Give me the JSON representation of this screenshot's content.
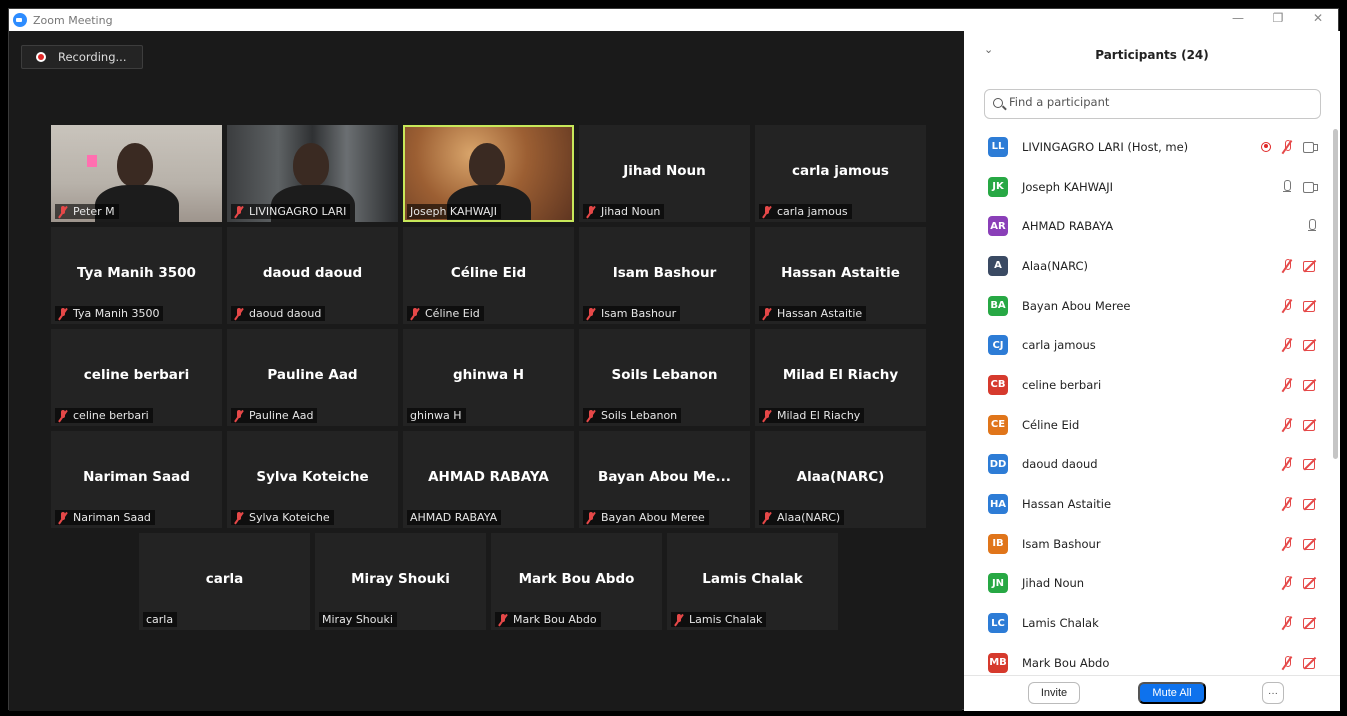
{
  "window": {
    "title": "Zoom Meeting",
    "controls": [
      "—",
      "❐",
      "✕"
    ]
  },
  "recording": {
    "label": "Recording..."
  },
  "tiles": [
    [
      {
        "name": "Peter M",
        "display": "",
        "muted": true,
        "video": "v1"
      },
      {
        "name": "LIVINGAGRO LARI",
        "display": "",
        "muted": true,
        "video": "v2"
      },
      {
        "name": "Joseph KAHWAJI",
        "display": "",
        "muted": false,
        "video": "v3",
        "active": true
      },
      {
        "name": "Jihad Noun",
        "display": "Jihad Noun",
        "muted": true
      },
      {
        "name": "carla jamous",
        "display": "carla jamous",
        "muted": true
      }
    ],
    [
      {
        "name": "Tya Manih 3500",
        "display": "Tya Manih 3500",
        "muted": true
      },
      {
        "name": "daoud daoud",
        "display": "daoud daoud",
        "muted": true
      },
      {
        "name": "Céline Eid",
        "display": "Céline Eid",
        "muted": true
      },
      {
        "name": "Isam Bashour",
        "display": "Isam Bashour",
        "muted": true
      },
      {
        "name": "Hassan Astaitie",
        "display": "Hassan Astaitie",
        "muted": true
      }
    ],
    [
      {
        "name": "celine berbari",
        "display": "celine berbari",
        "muted": true
      },
      {
        "name": "Pauline Aad",
        "display": "Pauline Aad",
        "muted": true
      },
      {
        "name": "ghinwa H",
        "display": "ghinwa H",
        "muted": false
      },
      {
        "name": "Soils Lebanon",
        "display": "Soils Lebanon",
        "muted": true
      },
      {
        "name": "Milad El Riachy",
        "display": "Milad El Riachy",
        "muted": true
      }
    ],
    [
      {
        "name": "Nariman Saad",
        "display": "Nariman Saad",
        "muted": true
      },
      {
        "name": "Sylva Koteiche",
        "display": "Sylva Koteiche",
        "muted": true
      },
      {
        "name": "AHMAD RABAYA",
        "display": "AHMAD RABAYA",
        "muted": false
      },
      {
        "name": "Bayan Abou Meree",
        "display": "Bayan Abou Me...",
        "muted": true
      },
      {
        "name": "Alaa(NARC)",
        "display": "Alaa(NARC)",
        "muted": true
      }
    ],
    [
      {
        "name": "carla",
        "display": "carla",
        "muted": false
      },
      {
        "name": "Miray Shouki",
        "display": "Miray Shouki",
        "muted": false
      },
      {
        "name": "Mark Bou Abdo",
        "display": "Mark Bou Abdo",
        "muted": true
      },
      {
        "name": "Lamis Chalak",
        "display": "Lamis Chalak",
        "muted": true
      }
    ]
  ],
  "panel": {
    "title": "Participants (24)",
    "search_placeholder": "Find a participant",
    "participants": [
      {
        "initials": "LL",
        "name": "LIVINGAGRO LARI (Host, me)",
        "color": "#2d7cd6",
        "icons": [
          "rec",
          "mic-off",
          "cam"
        ]
      },
      {
        "initials": "JK",
        "name": "Joseph KAHWAJI",
        "color": "#27a844",
        "icons": [
          "mic",
          "cam"
        ]
      },
      {
        "initials": "AR",
        "name": "AHMAD RABAYA",
        "color": "#8a3fb8",
        "icons": [
          "mic"
        ]
      },
      {
        "initials": "A",
        "name": "Alaa(NARC)",
        "color": "#3a4a63",
        "icons": [
          "mic-off",
          "cam-off"
        ]
      },
      {
        "initials": "BA",
        "name": "Bayan Abou Meree",
        "color": "#27a844",
        "icons": [
          "mic-off",
          "cam-off"
        ]
      },
      {
        "initials": "CJ",
        "name": "carla jamous",
        "color": "#2d7cd6",
        "icons": [
          "mic-off",
          "cam-off"
        ]
      },
      {
        "initials": "CB",
        "name": "celine berbari",
        "color": "#d63a2d",
        "icons": [
          "mic-off",
          "cam-off"
        ]
      },
      {
        "initials": "CE",
        "name": "Céline Eid",
        "color": "#e0751a",
        "icons": [
          "mic-off",
          "cam-off"
        ]
      },
      {
        "initials": "DD",
        "name": "daoud daoud",
        "color": "#2d7cd6",
        "icons": [
          "mic-off",
          "cam-off"
        ]
      },
      {
        "initials": "HA",
        "name": "Hassan Astaitie",
        "color": "#2d7cd6",
        "icons": [
          "mic-off",
          "cam-off"
        ]
      },
      {
        "initials": "IB",
        "name": "Isam Bashour",
        "color": "#e0751a",
        "icons": [
          "mic-off",
          "cam-off"
        ]
      },
      {
        "initials": "JN",
        "name": "Jihad Noun",
        "color": "#27a844",
        "icons": [
          "mic-off",
          "cam-off"
        ]
      },
      {
        "initials": "LC",
        "name": "Lamis Chalak",
        "color": "#2d7cd6",
        "icons": [
          "mic-off",
          "cam-off"
        ]
      },
      {
        "initials": "MB",
        "name": "Mark Bou Abdo",
        "color": "#d63a2d",
        "icons": [
          "mic-off",
          "cam-off"
        ]
      }
    ],
    "footer": {
      "invite": "Invite",
      "mute_all": "Mute All",
      "more": "···"
    }
  }
}
